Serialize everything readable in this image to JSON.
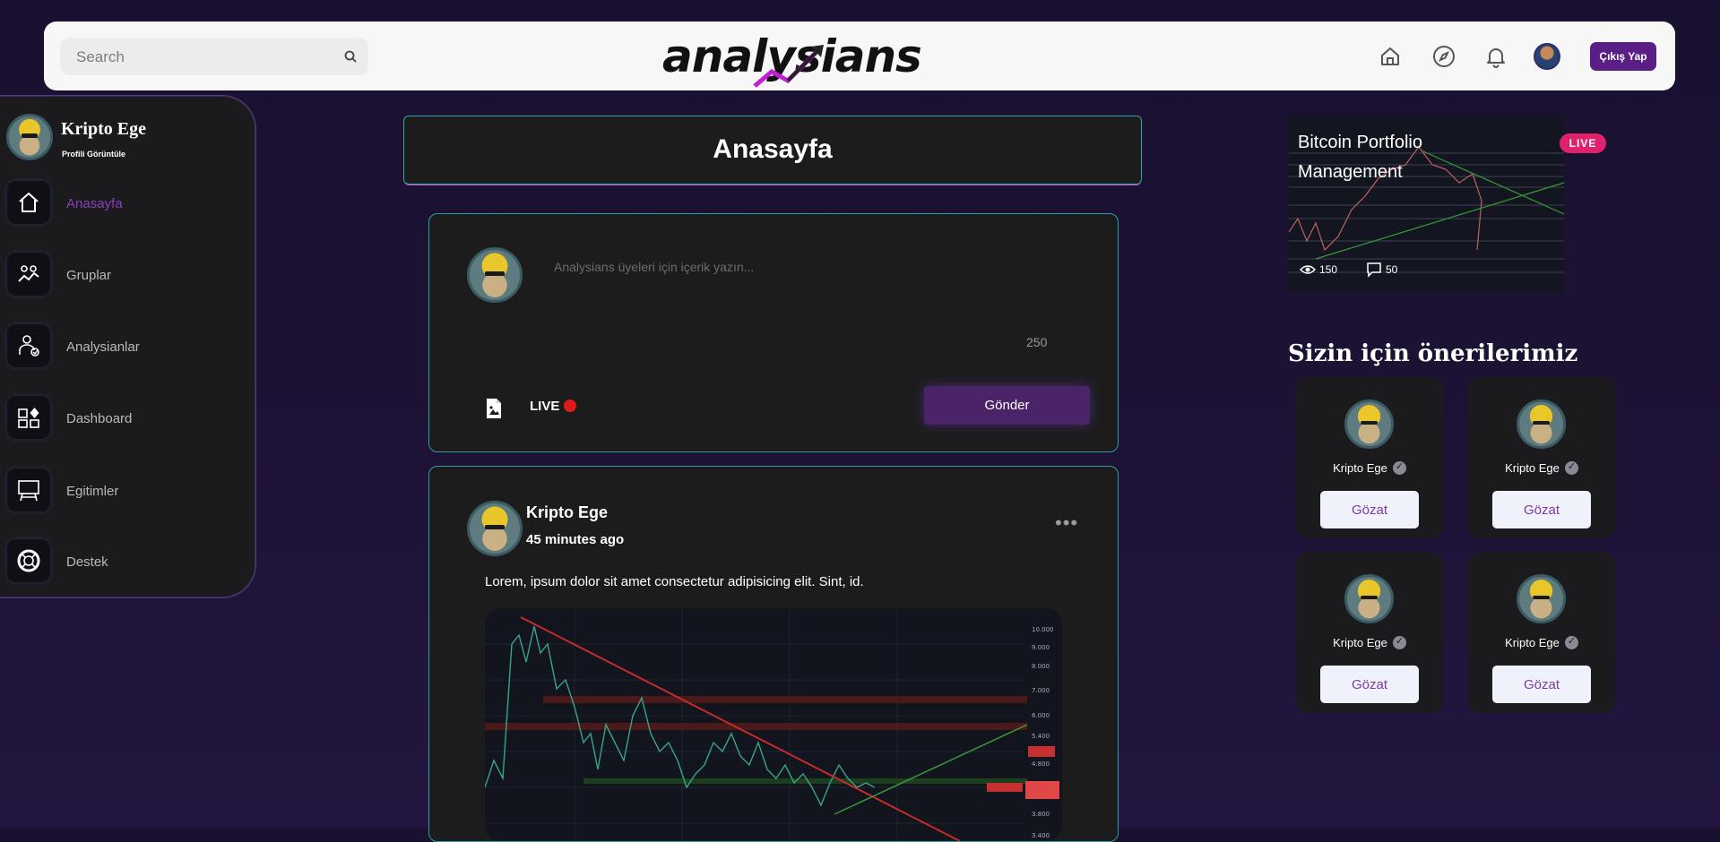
{
  "header": {
    "search_placeholder": "Search",
    "logo_text": "analysians",
    "logout_label": "Çıkış Yap",
    "icons": [
      "home-icon",
      "compass-icon",
      "bell-icon",
      "user-avatar"
    ]
  },
  "sidebar": {
    "profile_name": "Kripto Ege",
    "profile_link": "Profili Görüntüle",
    "items": [
      {
        "label": "Anasayfa",
        "icon": "home-icon",
        "active": true
      },
      {
        "label": "Gruplar",
        "icon": "group-chart-icon"
      },
      {
        "label": "Analysianlar",
        "icon": "analyst-icon"
      },
      {
        "label": "Dashboard",
        "icon": "dashboard-icon"
      },
      {
        "label": "Egitimler",
        "icon": "board-icon"
      },
      {
        "label": "Destek",
        "icon": "lifebuoy-icon"
      }
    ]
  },
  "main": {
    "page_title": "Anasayfa",
    "compose": {
      "placeholder": "Analysians üyeleri için içerik yazın...",
      "char_count": "250",
      "live_label": "LIVE",
      "send_label": "Gönder"
    },
    "post": {
      "author": "Kripto Ege",
      "time": "45 minutes ago",
      "text": "Lorem, ipsum dolor sit amet consectetur adipisicing elit. Sint, id."
    }
  },
  "right": {
    "live_card": {
      "title": "Bitcoin Portfolio Management",
      "badge": "LIVE",
      "views": "150",
      "comments": "50"
    },
    "recommendations_title": "Sizin için önerilerimiz",
    "recommendations": [
      {
        "name": "Kripto Ege",
        "button": "Gözat"
      },
      {
        "name": "Kripto Ege",
        "button": "Gözat"
      },
      {
        "name": "Kripto Ege",
        "button": "Gözat"
      },
      {
        "name": "Kripto Ege",
        "button": "Gözat"
      }
    ]
  },
  "colors": {
    "accent_purple": "#5b1e86",
    "active_nav": "#8b3db8",
    "card_border": "#2a9ea3",
    "live_red": "#e01818",
    "live_badge": "#e0216b"
  }
}
